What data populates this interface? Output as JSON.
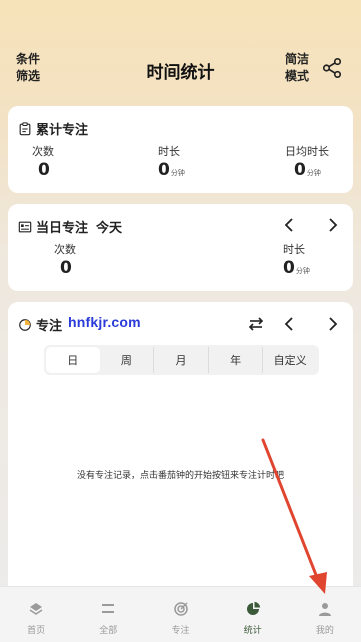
{
  "header": {
    "filter_label": "条件\n筛选",
    "title": "时间统计",
    "mode_label": "简洁\n模式",
    "share_icon": "share-icon"
  },
  "cumulative": {
    "title": "累计专注",
    "count_label": "次数",
    "count_value": "0",
    "duration_label": "时长",
    "duration_value": "0",
    "duration_unit": "分钟",
    "daily_label": "日均时长",
    "daily_value": "0",
    "daily_unit": "分钟"
  },
  "today": {
    "title": "当日专注",
    "date_label": "今天",
    "count_label": "次数",
    "count_value": "0",
    "duration_label": "时长",
    "duration_value": "0",
    "duration_unit": "分钟"
  },
  "distribution": {
    "title": "专注",
    "watermark": "hnfkjr.com",
    "tabs": [
      "日",
      "周",
      "月",
      "年",
      "自定义"
    ],
    "selected_tab": "日",
    "empty_message": "没有专注记录，点击番茄钟的开始按钮来专注计时吧"
  },
  "tabbar": {
    "items": [
      {
        "label": "首页",
        "icon": "layers-icon"
      },
      {
        "label": "全部",
        "icon": "list-icon"
      },
      {
        "label": "专注",
        "icon": "target-icon"
      },
      {
        "label": "统计",
        "icon": "pie-chart-icon"
      },
      {
        "label": "我的",
        "icon": "person-icon"
      }
    ],
    "active": "统计"
  },
  "colors": {
    "active_tab": "#3b5a3a",
    "annotation_arrow": "#e0452f",
    "watermark": "#2a3bd9"
  }
}
